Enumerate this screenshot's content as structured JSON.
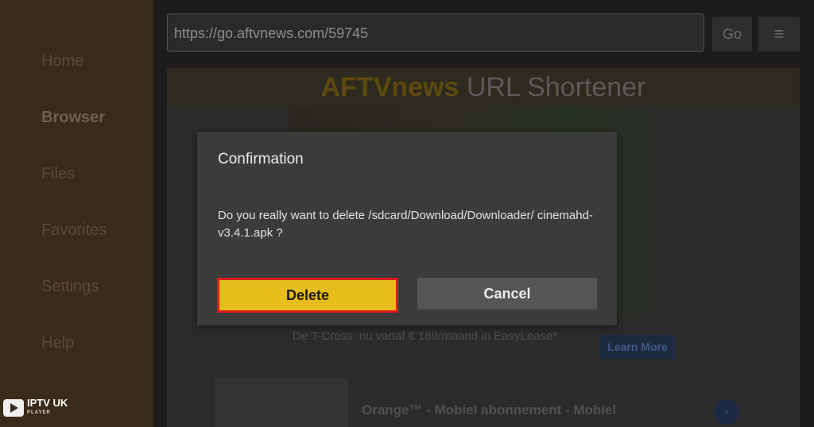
{
  "sidebar": {
    "items": [
      {
        "label": "Home",
        "active": false
      },
      {
        "label": "Browser",
        "active": true
      },
      {
        "label": "Files",
        "active": false
      },
      {
        "label": "Favorites",
        "active": false
      },
      {
        "label": "Settings",
        "active": false
      },
      {
        "label": "Help",
        "active": false
      }
    ]
  },
  "watermark": {
    "name": "IPTV UK",
    "sub": "PLAYER"
  },
  "toolbar": {
    "url": "https://go.aftvnews.com/59745",
    "go_label": "Go",
    "menu_icon": "≡"
  },
  "page": {
    "brand": "AFTVnews",
    "title_rest": " URL Shortener",
    "ad_text": "De T-Cross: nu vanaf € 189/maand in EasyLease*",
    "learn_more": "Learn More",
    "ad2_text": "Orange™ - Mobiel abonnement - Mobiel"
  },
  "dialog": {
    "title": "Confirmation",
    "message": "Do you really want to delete /sdcard/Download/Downloader/ cinemahd-v3.4.1.apk ?",
    "delete_label": "Delete",
    "cancel_label": "Cancel"
  },
  "colors": {
    "accent_yellow": "#e6bd1a",
    "focus_red": "#e0191c",
    "sidebar_bg": "#3a2a1a"
  }
}
